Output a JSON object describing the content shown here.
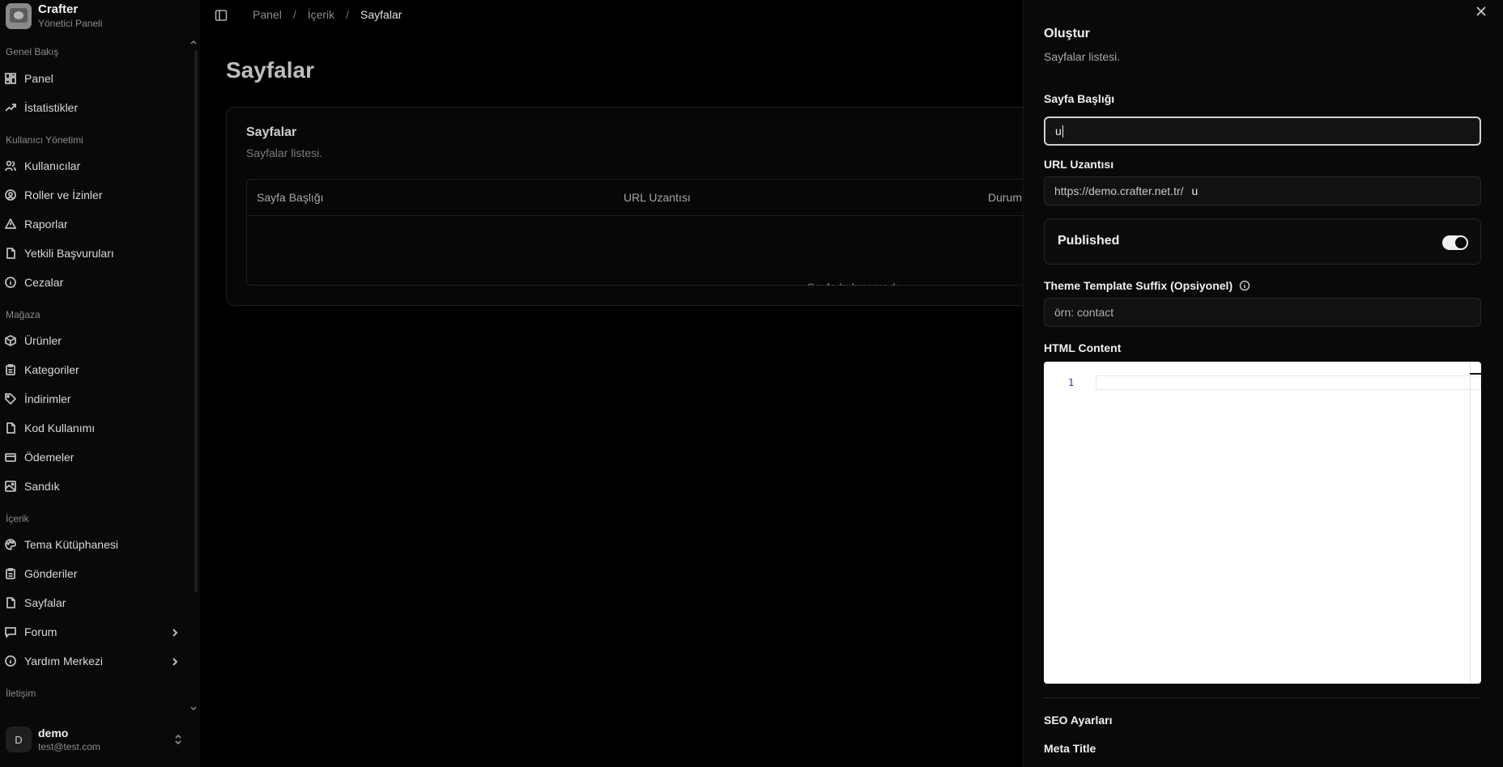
{
  "brand": {
    "name": "Crafter",
    "subtitle": "Yönetici Paneli"
  },
  "sidebar": {
    "groups": [
      {
        "label": "Genel Bakış"
      },
      {
        "label": "Kullanıcı Yönetimi"
      },
      {
        "label": "Mağaza"
      },
      {
        "label": "İçerik"
      },
      {
        "label": "İletişim"
      }
    ],
    "items": [
      {
        "label": "Panel",
        "icon": "dashboard-icon"
      },
      {
        "label": "İstatistikler",
        "icon": "trending-up-icon"
      },
      {
        "label": "Kullanıcılar",
        "icon": "users-icon"
      },
      {
        "label": "Roller ve İzinler",
        "icon": "user-circle-icon"
      },
      {
        "label": "Raporlar",
        "icon": "warning-icon"
      },
      {
        "label": "Yetkili Başvuruları",
        "icon": "file-icon"
      },
      {
        "label": "Cezalar",
        "icon": "info-circle-icon"
      },
      {
        "label": "Ürünler",
        "icon": "box-icon"
      },
      {
        "label": "Kategoriler",
        "icon": "clipboard-icon"
      },
      {
        "label": "İndirimler",
        "icon": "tag-icon"
      },
      {
        "label": "Kod Kullanımı",
        "icon": "file-icon"
      },
      {
        "label": "Ödemeler",
        "icon": "credit-card-icon"
      },
      {
        "label": "Sandık",
        "icon": "image-icon"
      },
      {
        "label": "Tema Kütüphanesi",
        "icon": "palette-icon"
      },
      {
        "label": "Gönderiler",
        "icon": "clipboard-icon"
      },
      {
        "label": "Sayfalar",
        "icon": "file-icon"
      },
      {
        "label": "Forum",
        "icon": "message-icon"
      },
      {
        "label": "Yardım Merkezi",
        "icon": "info-circle-icon"
      }
    ]
  },
  "user": {
    "initial": "D",
    "name": "demo",
    "email": "test@test.com"
  },
  "breadcrumb": {
    "items": [
      "Panel",
      "İçerik",
      "Sayfalar"
    ],
    "separator": "/"
  },
  "main": {
    "title": "Sayfalar",
    "card": {
      "title": "Sayfalar",
      "subtitle": "Sayfalar listesi.",
      "columns": [
        "Sayfa Başlığı",
        "URL Uzantısı",
        "Durum"
      ],
      "empty": "Sayfa bulunamadı."
    }
  },
  "panel": {
    "title": "Oluştur",
    "subtitle": "Sayfalar listesi.",
    "page_title_label": "Sayfa Başlığı",
    "page_title_value": "u",
    "url_label": "URL Uzantısı",
    "url_prefix": "https://demo.crafter.net.tr/",
    "url_value": "u",
    "published_label": "Published",
    "published_on": true,
    "theme_suffix_label": "Theme Template Suffix (Opsiyonel)",
    "theme_suffix_placeholder": "örn: contact",
    "html_label": "HTML Content",
    "editor_line": "1",
    "seo_label": "SEO Ayarları",
    "meta_title_label": "Meta Title"
  }
}
